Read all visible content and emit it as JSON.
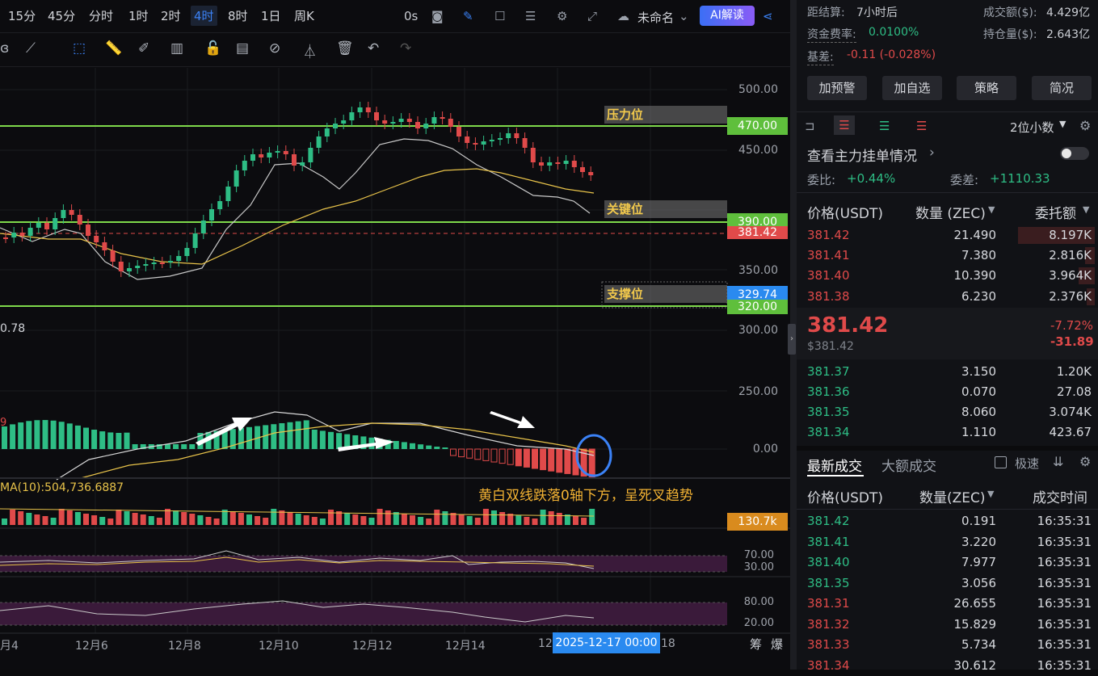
{
  "toolbar": {
    "timeframes": [
      "15分",
      "45分",
      "分时",
      "1时",
      "2时",
      "4时",
      "8时",
      "1日",
      "周K"
    ],
    "active_timeframe": "4时",
    "countdown": "0s",
    "layout_name": "未命名",
    "ai_button": "AI解读"
  },
  "chart": {
    "price_axis": [
      "500.00",
      "450.00",
      "350.00",
      "300.00",
      "250.00",
      "0.00"
    ],
    "tags": {
      "resistance": "470.00",
      "key": "390.00",
      "current": "381.42",
      "support_blue": "329.74",
      "support": "320.00"
    },
    "levels": {
      "resistance_label": "压力位",
      "key_label": "关键位",
      "support_label": "支撑位"
    },
    "left_value": "0.78",
    "macd_left": "9",
    "volume_ma": "MA(10):504,736.6887",
    "volume_tag": "130.7k",
    "annotation": "黄白双线跌落0轴下方，呈死叉趋势",
    "rsi_axis": [
      "70.00",
      "30.00"
    ],
    "kdj_axis": [
      "80.00",
      "20.00"
    ],
    "dates": [
      "月4",
      "12月6",
      "12月8",
      "12月10",
      "12月12",
      "12月14",
      "12",
      "18"
    ],
    "crosshair_date": "2025-12-17 00:00",
    "bottom_icons": [
      "筹",
      "爆"
    ],
    "colors": {
      "up": "#2ebd85",
      "down": "#e04a4a",
      "level": "#7fd94b",
      "accent": "#3b82f6"
    }
  },
  "info": {
    "settle_label": "距结算:",
    "settle_value": "7小时后",
    "funding_label": "资金费率:",
    "funding_value": "0.0100%",
    "basis_label": "基差:",
    "basis_value": "-0.11 (-0.028%)",
    "turnover_label": "成交额($):",
    "turnover_value": "4.429亿",
    "oi_label": "持仓量($):",
    "oi_value": "2.643亿"
  },
  "actions": [
    "加预警",
    "加自选",
    "策略",
    "简况"
  ],
  "orderbook": {
    "precision": "2位小数",
    "main_orders": "查看主力挂单情况",
    "weibi_label": "委比:",
    "weibi_value": "+0.44%",
    "weicha_label": "委差:",
    "weicha_value": "+1110.33",
    "headers": [
      "价格(USDT)",
      "数量 (ZEC)",
      "委托额"
    ],
    "asks": [
      {
        "price": "381.42",
        "qty": "21.490",
        "total": "8.197K",
        "depth": 0.95
      },
      {
        "price": "381.41",
        "qty": "7.380",
        "total": "2.816K",
        "depth": 0.12
      },
      {
        "price": "381.40",
        "qty": "10.390",
        "total": "3.964K",
        "depth": 0.2
      },
      {
        "price": "381.38",
        "qty": "6.230",
        "total": "2.376K",
        "depth": 0.1
      }
    ],
    "last_price": "381.42",
    "last_usd": "$381.42",
    "change_pct": "-7.72%",
    "change_abs": "-31.89",
    "bids": [
      {
        "price": "381.37",
        "qty": "3.150",
        "total": "1.20K"
      },
      {
        "price": "381.36",
        "qty": "0.070",
        "total": "27.08"
      },
      {
        "price": "381.35",
        "qty": "8.060",
        "total": "3.074K"
      },
      {
        "price": "381.34",
        "qty": "1.110",
        "total": "423.67"
      }
    ]
  },
  "trades": {
    "tab_latest": "最新成交",
    "tab_large": "大额成交",
    "fast_label": "极速",
    "headers": [
      "价格(USDT)",
      "数量(ZEC)",
      "成交时间"
    ],
    "rows": [
      {
        "price": "381.42",
        "qty": "0.191",
        "time": "16:35:31",
        "side": "buy"
      },
      {
        "price": "381.41",
        "qty": "3.220",
        "time": "16:35:31",
        "side": "buy"
      },
      {
        "price": "381.40",
        "qty": "7.977",
        "time": "16:35:31",
        "side": "buy"
      },
      {
        "price": "381.35",
        "qty": "3.056",
        "time": "16:35:31",
        "side": "buy"
      },
      {
        "price": "381.31",
        "qty": "26.655",
        "time": "16:35:31",
        "side": "sell"
      },
      {
        "price": "381.32",
        "qty": "15.829",
        "time": "16:35:31",
        "side": "sell"
      },
      {
        "price": "381.33",
        "qty": "5.734",
        "time": "16:35:31",
        "side": "sell"
      },
      {
        "price": "381.34",
        "qty": "30.612",
        "time": "16:35:31",
        "side": "sell"
      }
    ]
  }
}
